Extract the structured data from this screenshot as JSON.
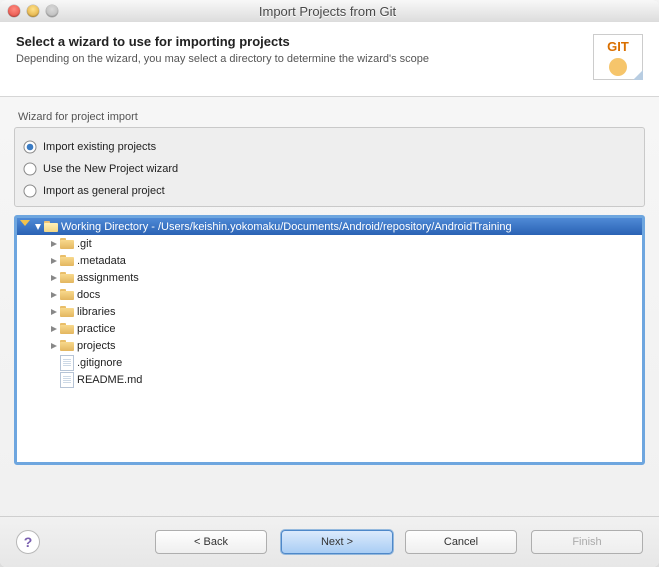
{
  "window_title": "Import Projects from Git",
  "banner": {
    "heading": "Select a wizard to use for importing projects",
    "sub": "Depending on the wizard, you may select a directory to determine the wizard's scope",
    "badge_text": "GIT"
  },
  "group_label": "Wizard for project import",
  "radios": {
    "existing": "Import existing projects",
    "newproj": "Use the New Project wizard",
    "general": "Import as general project"
  },
  "tree": {
    "root_label": "Working Directory - /Users/keishin.yokomaku/Documents/Android/repository/AndroidTraining",
    "children": [
      {
        "type": "folder",
        "label": ".git"
      },
      {
        "type": "folder",
        "label": ".metadata"
      },
      {
        "type": "folder",
        "label": "assignments"
      },
      {
        "type": "folder",
        "label": "docs"
      },
      {
        "type": "folder",
        "label": "libraries"
      },
      {
        "type": "folder",
        "label": "practice"
      },
      {
        "type": "folder",
        "label": "projects"
      },
      {
        "type": "file",
        "label": ".gitignore"
      },
      {
        "type": "file",
        "label": "README.md"
      }
    ]
  },
  "buttons": {
    "back": "< Back",
    "next": "Next >",
    "cancel": "Cancel",
    "finish": "Finish",
    "help": "?"
  }
}
